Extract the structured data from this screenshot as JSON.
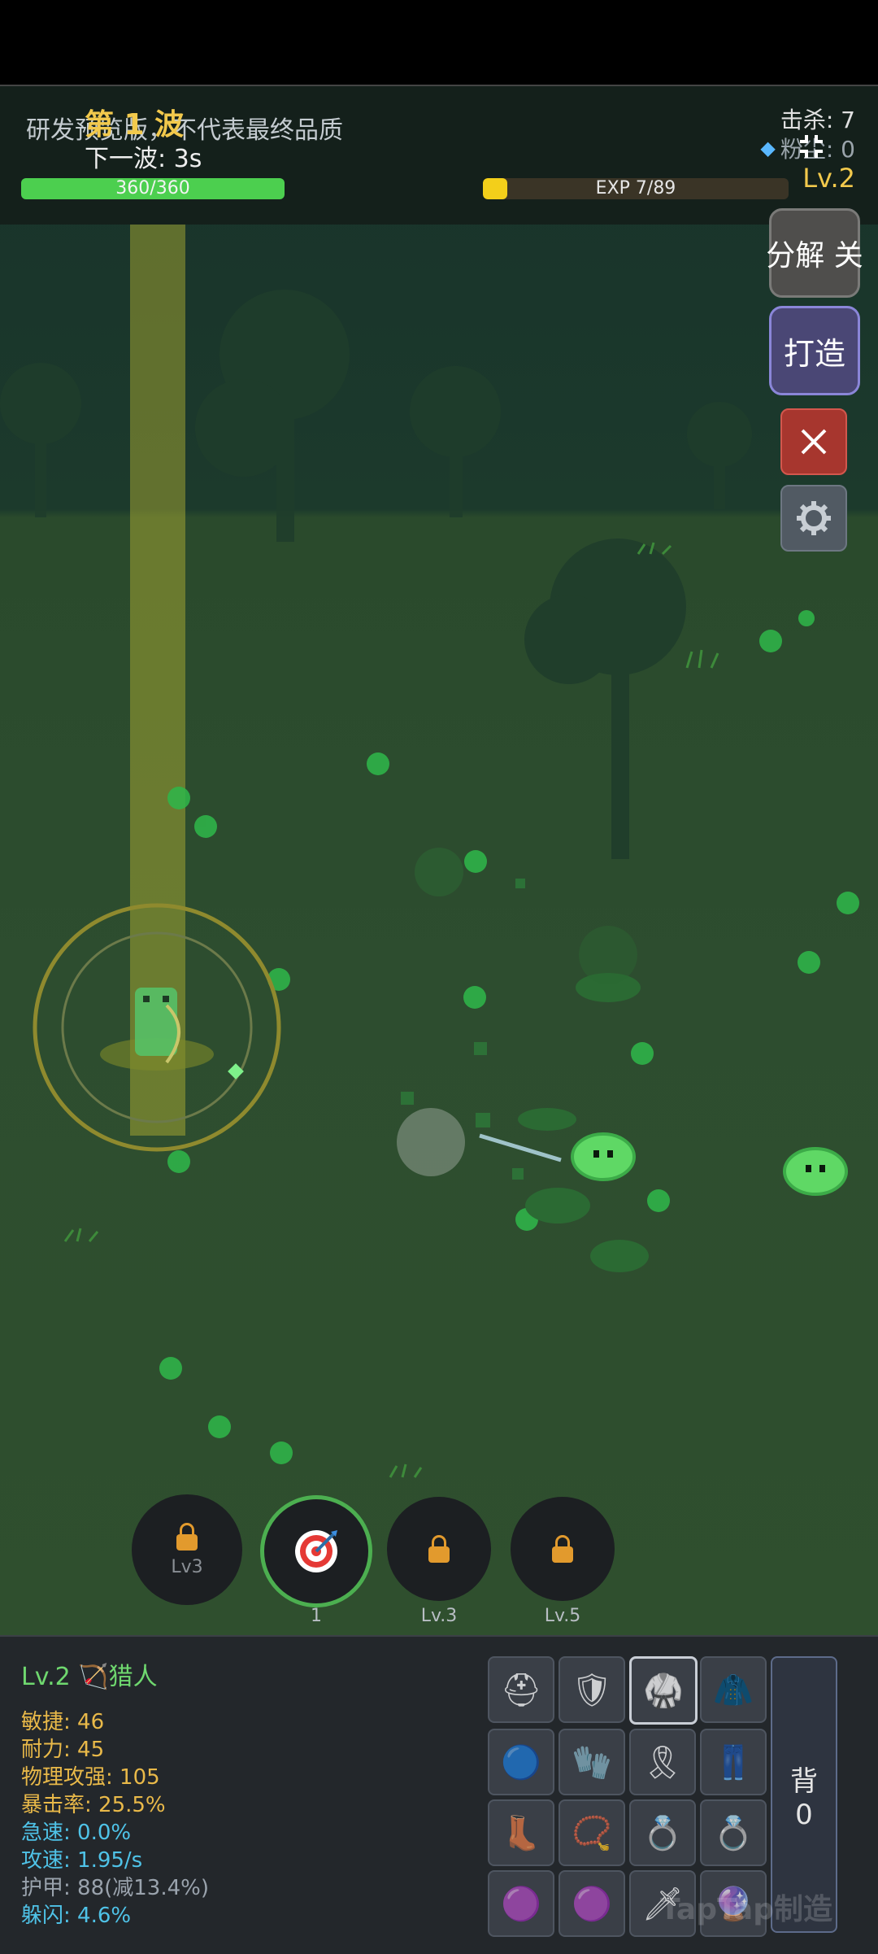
{
  "hud": {
    "wave_label": "第 1 波",
    "next_wave": "下一波: 3s",
    "preview_note": "研发预览版，不代表最终品质",
    "hp_text": "360/360",
    "hp_fraction": 1.0,
    "exp_text": "EXP 7/89",
    "exp_fraction": 0.0787,
    "kills": "击杀: 7",
    "powder": "粉尘: 0",
    "level": "Lv.2"
  },
  "side_buttons": {
    "decompose_label": "分解 关",
    "forge_label": "打造",
    "close_icon": "close-icon",
    "settings_icon": "gear-icon"
  },
  "skills": [
    {
      "label": "Lv3",
      "caption": "",
      "locked": true
    },
    {
      "label": "",
      "caption": "1",
      "locked": false,
      "icon": "target-icon"
    },
    {
      "label": "",
      "caption": "Lv.3",
      "locked": true
    },
    {
      "label": "",
      "caption": "Lv.5",
      "locked": true
    }
  ],
  "character": {
    "title": "Lv.2 🏹猎人",
    "stats": [
      {
        "text": "敏捷: 46",
        "color": "#e9b949"
      },
      {
        "text": "耐力: 45",
        "color": "#e9b949"
      },
      {
        "text": "物理攻强: 105",
        "color": "#e9b949"
      },
      {
        "text": "暴击率: 25.5%",
        "color": "#e9b949"
      },
      {
        "text": "急速: 0.0%",
        "color": "#4fc3e8"
      },
      {
        "text": "攻速: 1.95/s",
        "color": "#4fc3e8"
      },
      {
        "text": "护甲: 88(减13.4%)",
        "color": "#9aa3ad"
      },
      {
        "text": "躲闪: 4.6%",
        "color": "#4fc3e8"
      }
    ]
  },
  "equipment": {
    "slots": [
      "helmet-icon",
      "shoulders-icon",
      "chest-armor-icon",
      "cloak-icon",
      "bracer-icon",
      "gloves-icon",
      "belt-icon",
      "leggings-icon",
      "boots-icon",
      "necklace-icon",
      "ring-icon",
      "ring-icon",
      "trinket-icon",
      "trinket-icon",
      "weapon-icon",
      "offhand-icon"
    ],
    "bag_label": "背",
    "bag_count": "0"
  },
  "watermark": "TapTap制造"
}
